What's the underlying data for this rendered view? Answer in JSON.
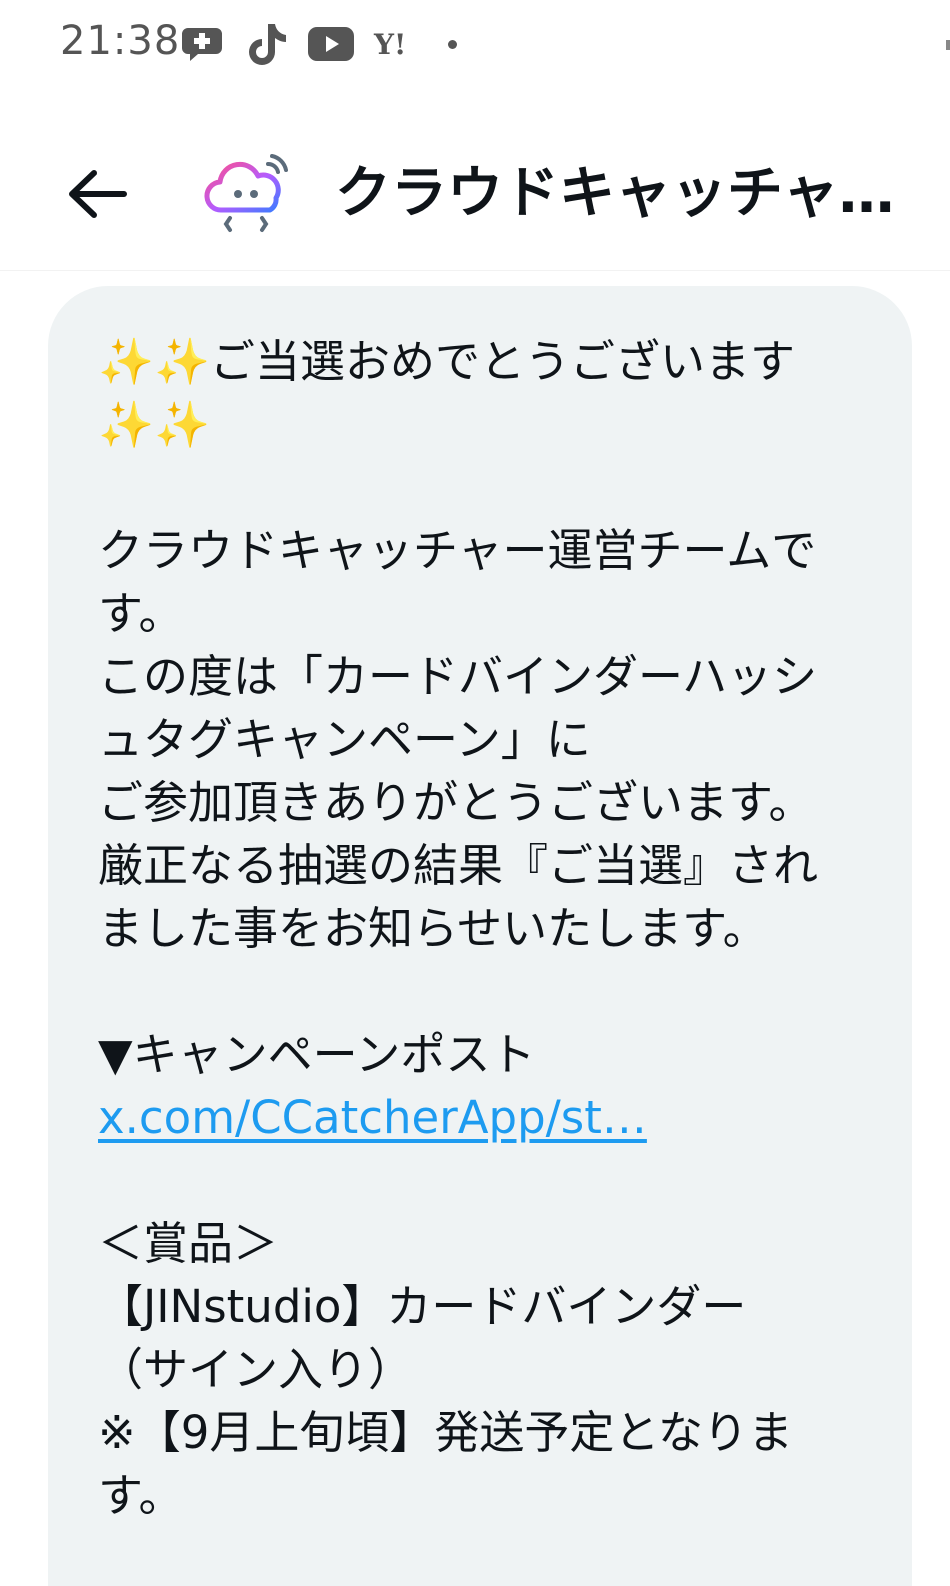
{
  "status_bar": {
    "time": "21:38",
    "icons": [
      "chat-plus-icon",
      "tiktok-icon",
      "youtube-icon",
      "yahoo-icon",
      "notification-dot-icon"
    ],
    "yahoo_label": "Y!"
  },
  "header": {
    "title": "クラウドキャッチャー…",
    "avatar_icon": "cloud-catcher-logo-icon",
    "back_icon": "back-arrow-icon"
  },
  "message": {
    "greeting_line1": "✨✨ご当選おめでとうございます",
    "greeting_line2": "✨✨",
    "body_lines": [
      "クラウドキャッチャー運営チームで",
      "す。",
      "この度は「カードバインダーハッシ",
      "ュタグキャンペーン」に",
      "ご参加頂きありがとうございます。",
      "厳正なる抽選の結果『ご当選』され",
      "ました事をお知らせいたします。"
    ],
    "campaign_heading": "▼キャンペーンポスト",
    "campaign_link": "x.com/CCatcherApp/st…",
    "prize_heading": "＜賞品＞",
    "prize_lines": [
      "【JINstudio】カードバインダー",
      "（サイン入り）",
      "※【9月上旬頃】発送予定となりま",
      "す。"
    ]
  },
  "colors": {
    "link": "#1d9bf0",
    "bubble_bg": "#eff3f4",
    "text": "#0f1419"
  }
}
